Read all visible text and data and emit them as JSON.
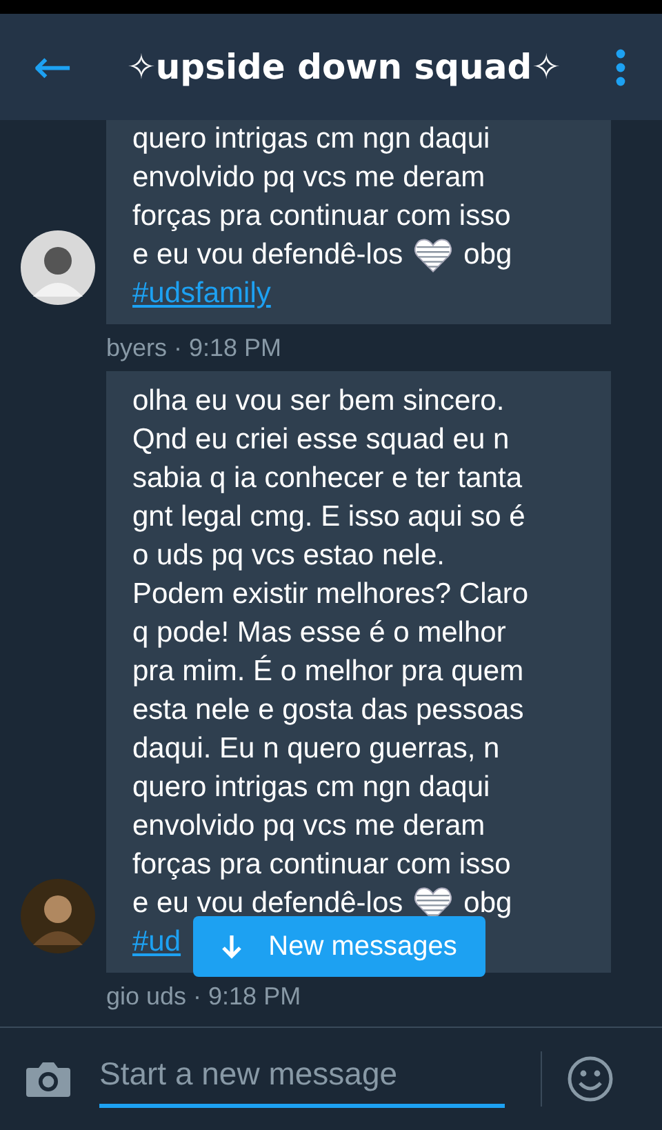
{
  "header": {
    "back_icon": "←",
    "title": "✧upside down squad✧"
  },
  "messages": [
    {
      "lines": [
        {
          "kind": "text",
          "text": "quero intrigas cm ngn daqui"
        },
        {
          "kind": "text",
          "text": "envolvido pq vcs me deram"
        },
        {
          "kind": "text",
          "text": "forças pra continuar com isso"
        },
        {
          "kind": "heart",
          "before": "e eu vou defendê-los",
          "after": "obg"
        },
        {
          "kind": "hashtag",
          "text": "#udsfamily"
        }
      ],
      "meta": "byers · 9:18 PM"
    },
    {
      "lines": [
        {
          "kind": "text",
          "text": "olha eu vou ser bem sincero."
        },
        {
          "kind": "text",
          "text": "Qnd eu criei esse squad eu n"
        },
        {
          "kind": "text",
          "text": "sabia q ia conhecer e ter tanta"
        },
        {
          "kind": "text",
          "text": "gnt legal cmg. E isso aqui so é"
        },
        {
          "kind": "text",
          "text": "o uds pq vcs estao nele."
        },
        {
          "kind": "text",
          "text": "Podem existir melhores? Claro"
        },
        {
          "kind": "text",
          "text": "q pode! Mas esse é o melhor"
        },
        {
          "kind": "text",
          "text": "pra mim. É o melhor pra quem"
        },
        {
          "kind": "text",
          "text": "esta nele e gosta das pessoas"
        },
        {
          "kind": "text",
          "text": "daqui. Eu n quero guerras, n"
        },
        {
          "kind": "text",
          "text": "quero intrigas cm ngn daqui"
        },
        {
          "kind": "text",
          "text": "envolvido pq vcs me deram"
        },
        {
          "kind": "text",
          "text": "forças pra continuar com isso"
        },
        {
          "kind": "heart",
          "before": "e eu vou defendê-los",
          "after": "obg"
        },
        {
          "kind": "hashtag",
          "text": "#ud"
        }
      ],
      "meta": "gio uds · 9:18 PM"
    }
  ],
  "new_messages_button": {
    "label": "New messages"
  },
  "composer": {
    "placeholder": "Start a new message"
  }
}
